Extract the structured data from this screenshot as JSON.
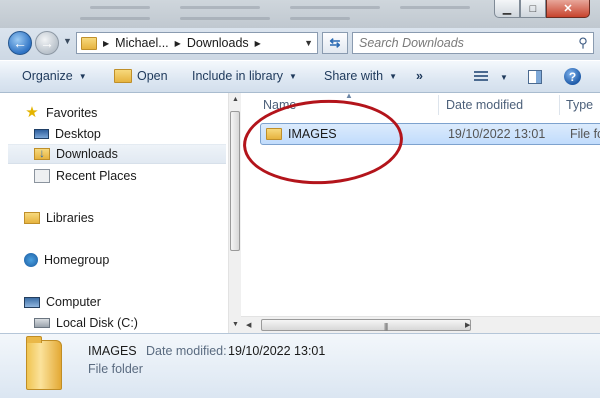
{
  "address": {
    "segments": [
      "Michael...",
      "Downloads"
    ],
    "refresh_icon": "refresh-icon"
  },
  "search": {
    "placeholder": "Search Downloads",
    "value": ""
  },
  "toolbar": {
    "organize": "Organize",
    "open": "Open",
    "include_in_library": "Include in library",
    "share_with": "Share with",
    "more": "»"
  },
  "nav": {
    "favorites": "Favorites",
    "desktop": "Desktop",
    "downloads": "Downloads",
    "recent_places": "Recent Places",
    "libraries": "Libraries",
    "homegroup": "Homegroup",
    "computer": "Computer",
    "local_disk": "Local Disk (C:)"
  },
  "columns": {
    "name": "Name",
    "date_modified": "Date modified",
    "type": "Type"
  },
  "files": [
    {
      "name": "IMAGES",
      "date_modified": "19/10/2022 13:01",
      "type": "File fo"
    }
  ],
  "details": {
    "name": "IMAGES",
    "date_label": "Date modified:",
    "date_value": "19/10/2022 13:01",
    "type": "File folder"
  },
  "colors": {
    "highlight_ring": "#b3141b",
    "selection": "#c1dcfc"
  }
}
